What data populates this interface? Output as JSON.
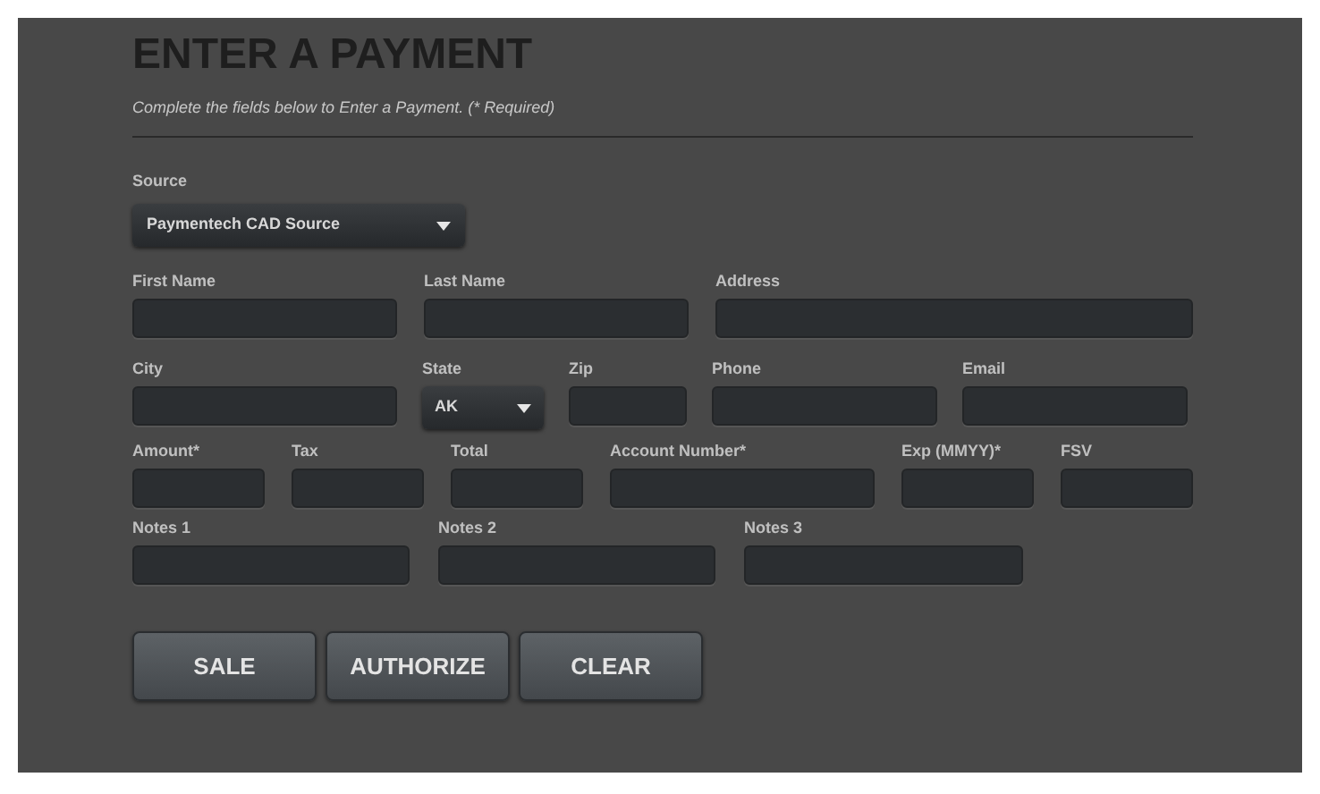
{
  "title": "ENTER A PAYMENT",
  "subtitle": "Complete the fields below to Enter a Payment. (* Required)",
  "source": {
    "label": "Source",
    "value": "Paymentech CAD Source"
  },
  "rows": [
    [
      {
        "label": "First Name",
        "kind": "text"
      },
      {
        "label": "Last Name",
        "kind": "text"
      },
      {
        "label": "Address",
        "kind": "text"
      }
    ],
    [
      {
        "label": "City",
        "kind": "text"
      },
      {
        "label": "State",
        "kind": "select",
        "value": "AK"
      },
      {
        "label": "Zip",
        "kind": "text"
      },
      {
        "label": "Phone",
        "kind": "text"
      },
      {
        "label": "Email",
        "kind": "text"
      }
    ],
    [
      {
        "label": "Amount*",
        "kind": "text"
      },
      {
        "label": "Tax",
        "kind": "text"
      },
      {
        "label": "Total",
        "kind": "text"
      },
      {
        "label": "Account Number*",
        "kind": "text"
      },
      {
        "label": "Exp (MMYY)*",
        "kind": "text"
      },
      {
        "label": "FSV",
        "kind": "text"
      }
    ],
    [
      {
        "label": "Notes 1",
        "kind": "text"
      },
      {
        "label": "Notes 2",
        "kind": "text"
      },
      {
        "label": "Notes 3",
        "kind": "text"
      }
    ]
  ],
  "buttons": [
    "SALE",
    "AUTHORIZE",
    "CLEAR"
  ]
}
